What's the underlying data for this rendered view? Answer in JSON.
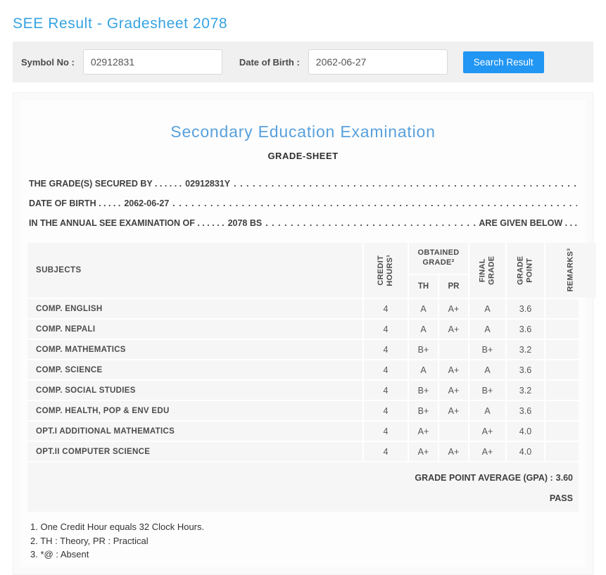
{
  "page": {
    "title": "SEE Result - Gradesheet 2078"
  },
  "search": {
    "symbol_label": "Symbol No :",
    "symbol_value": "02912831",
    "dob_label": "Date of Birth :",
    "dob_value": "2062-06-27",
    "button_label": "Search Result"
  },
  "sheet": {
    "heading": "Secondary Education Examination",
    "subheading": "GRADE-SHEET",
    "line1_prefix": "THE GRADE(S) SECURED BY . . . . . .",
    "line1_value": "02912831Y",
    "line2_prefix": "DATE OF BIRTH . . . . .",
    "line2_value": "2062-06-27",
    "line3_prefix": "IN THE ANNUAL SEE EXAMINATION OF . . . . . .",
    "line3_value": "2078 BS",
    "line3_suffix": "ARE GIVEN BELOW . . ."
  },
  "table": {
    "headers": {
      "subjects": "SUBJECTS",
      "credit_line1": "CREDIT",
      "credit_line2": "HOURS¹",
      "obtained_line1": "OBTAINED",
      "obtained_line2": "GRADE²",
      "th": "TH",
      "pr": "PR",
      "final_line1": "FINAL",
      "final_line2": "GRADE",
      "gp_line1": "GRADE",
      "gp_line2": "POINT",
      "remarks": "REMARKS³"
    },
    "rows": [
      {
        "subject": "COMP. ENGLISH",
        "credit": "4",
        "th": "A",
        "pr": "A+",
        "final": "A",
        "gp": "3.6",
        "remarks": ""
      },
      {
        "subject": "COMP. NEPALI",
        "credit": "4",
        "th": "A",
        "pr": "A+",
        "final": "A",
        "gp": "3.6",
        "remarks": ""
      },
      {
        "subject": "COMP. MATHEMATICS",
        "credit": "4",
        "th": "B+",
        "pr": "",
        "final": "B+",
        "gp": "3.2",
        "remarks": ""
      },
      {
        "subject": "COMP. SCIENCE",
        "credit": "4",
        "th": "A",
        "pr": "A+",
        "final": "A",
        "gp": "3.6",
        "remarks": ""
      },
      {
        "subject": "COMP. SOCIAL STUDIES",
        "credit": "4",
        "th": "B+",
        "pr": "A+",
        "final": "B+",
        "gp": "3.2",
        "remarks": ""
      },
      {
        "subject": "COMP. HEALTH, POP & ENV EDU",
        "credit": "4",
        "th": "B+",
        "pr": "A+",
        "final": "A",
        "gp": "3.6",
        "remarks": ""
      },
      {
        "subject": "OPT.I ADDITIONAL MATHEMATICS",
        "credit": "4",
        "th": "A+",
        "pr": "",
        "final": "A+",
        "gp": "4.0",
        "remarks": ""
      },
      {
        "subject": "OPT.II COMPUTER SCIENCE",
        "credit": "4",
        "th": "A+",
        "pr": "A+",
        "final": "A+",
        "gp": "4.0",
        "remarks": ""
      }
    ]
  },
  "summary": {
    "gpa_label": "GRADE POINT AVERAGE (GPA) :",
    "gpa_value": "3.60",
    "result": "PASS"
  },
  "footnotes": [
    "1. One Credit Hour equals 32 Clock Hours.",
    "2. TH : Theory, PR : Practical",
    "3. *@ : Absent"
  ],
  "colors": {
    "title_blue": "#36a3e2",
    "heading_blue": "#58a0dd",
    "button_blue": "#2196f3",
    "bar_gray": "#f0f0f0",
    "cell_gray": "#f6f6f6"
  }
}
